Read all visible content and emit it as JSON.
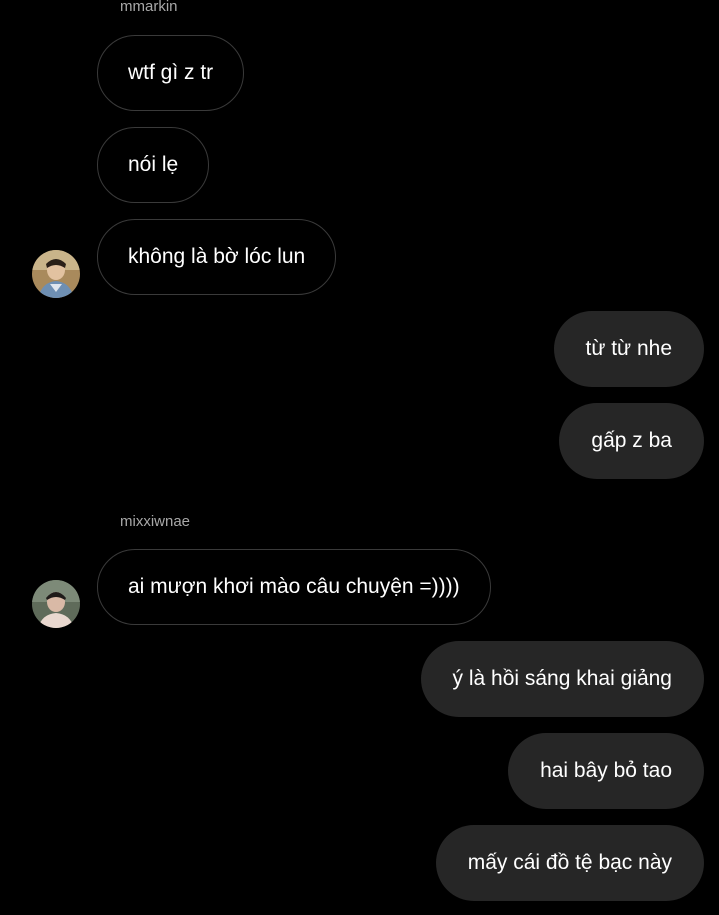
{
  "colors": {
    "background": "#000000",
    "incoming_border": "#3a3a3a",
    "outgoing_fill": "#262626",
    "username": "#a8a8a8",
    "text": "#ffffff"
  },
  "conversation": {
    "groups": [
      {
        "sender": "mmarkin",
        "avatar_icon": "user-avatar-photo",
        "messages": [
          "wtf gì z tr",
          "nói lẹ",
          "không là bờ lóc lun"
        ]
      },
      {
        "sender": "me",
        "messages": [
          "từ từ nhe",
          "gấp z ba"
        ]
      },
      {
        "sender": "mixxiwnae",
        "avatar_icon": "user-avatar-photo",
        "messages": [
          "ai mượn khơi mào câu chuyện =))))"
        ]
      },
      {
        "sender": "me",
        "messages": [
          "ý là hồi sáng khai giảng",
          "hai bây bỏ tao",
          "mấy cái đồ tệ bạc này"
        ]
      }
    ]
  }
}
